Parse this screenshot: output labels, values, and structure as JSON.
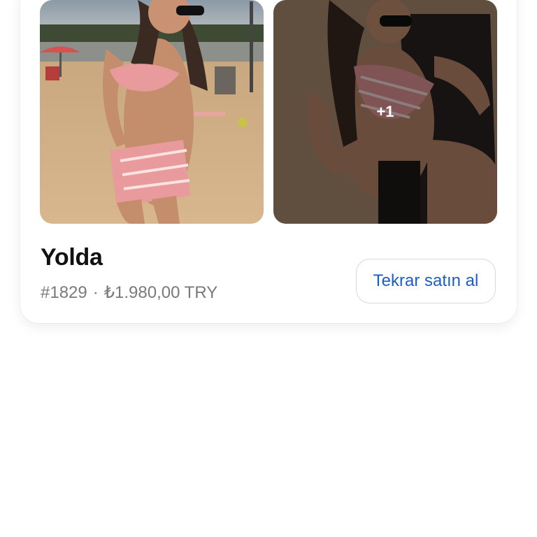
{
  "order": {
    "title": "Yolda",
    "number": "#1829",
    "separator": "·",
    "total": "₺1.980,00 TRY",
    "reorder_label": "Tekrar satın al",
    "more_images_count": "+1",
    "images": [
      {
        "name": "product-photo-beach"
      },
      {
        "name": "product-photo-lounge"
      }
    ]
  },
  "colors": {
    "accent": "#1a5fc9",
    "meta_text": "#7a7a7a",
    "title_text": "#111111",
    "bikini_pink": "#e99a9c"
  }
}
